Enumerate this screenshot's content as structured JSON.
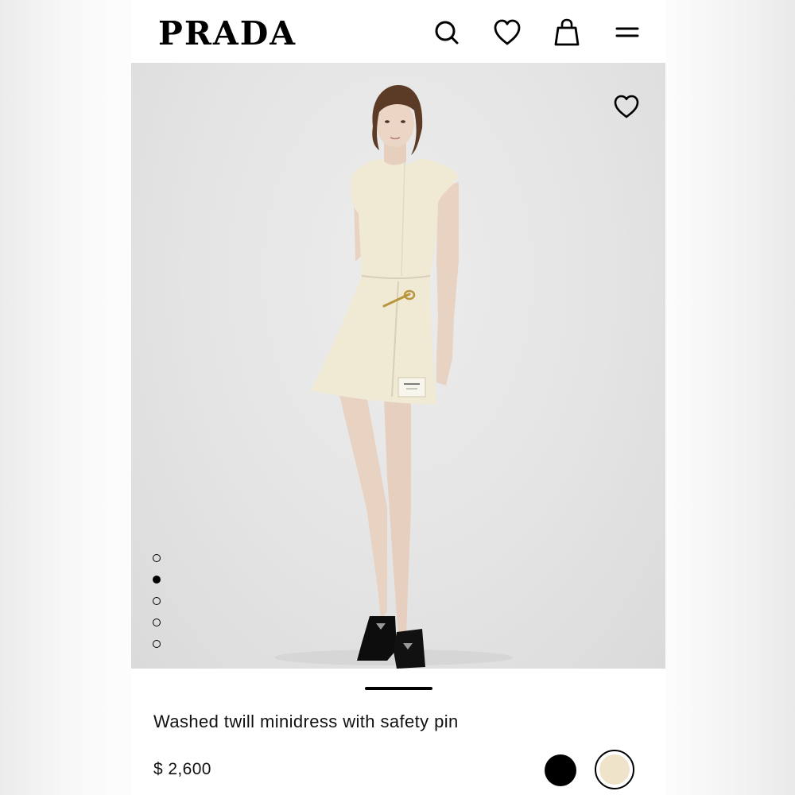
{
  "header": {
    "brand": "PRADA",
    "icons": [
      "search-icon",
      "heart-icon",
      "shopping-bag-icon",
      "menu-icon"
    ]
  },
  "gallery": {
    "image_count": 5,
    "active_index": 1,
    "wishlist_icon": "heart-icon"
  },
  "product": {
    "title": "Washed twill minidress with safety pin",
    "price": "$ 2,600",
    "colors": [
      {
        "name": "black",
        "hex": "#000000"
      },
      {
        "name": "cream",
        "hex": "#efe3ca",
        "selected": true
      }
    ]
  }
}
